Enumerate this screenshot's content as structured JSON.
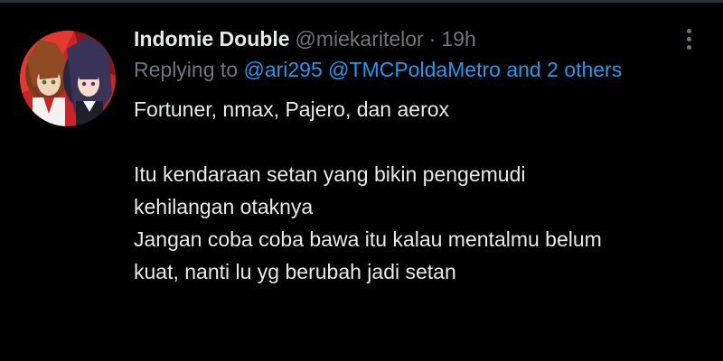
{
  "tweet": {
    "author": {
      "display_name": "Indomie Double",
      "handle": "@miekaritelor",
      "avatar_icon": "anime-characters-avatar"
    },
    "separator": "·",
    "time": "19h",
    "reply": {
      "prefix": "Replying to",
      "mentions": [
        "@ari295",
        "@TMCPoldaMetro",
        "and 2 others"
      ]
    },
    "text_lines": [
      "Fortuner, nmax, Pajero, dan aerox",
      "",
      "Itu kendaraan setan yang bikin pengemudi",
      "kehilangan otaknya",
      "Jangan coba coba bawa itu kalau mentalmu belum",
      "kuat, nanti lu yg berubah jadi setan"
    ],
    "more_icon": "more-vertical-icon"
  },
  "colors": {
    "background": "#000000",
    "text": "#e7e9ea",
    "secondary": "#71767b",
    "link": "#1d9bf0",
    "divider": "#2f3336"
  }
}
